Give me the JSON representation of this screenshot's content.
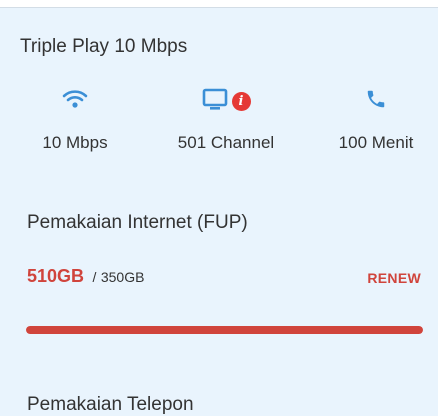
{
  "plan": {
    "title": "Triple Play 10 Mbps",
    "features": [
      {
        "icon": "wifi-icon",
        "label": "10 Mbps"
      },
      {
        "icon": "tv-icon",
        "label": "501 Channel",
        "badge": "i"
      },
      {
        "icon": "phone-icon",
        "label": "100 Menit"
      }
    ]
  },
  "usage": {
    "title": "Pemakaian Internet (FUP)",
    "used": "510GB",
    "separator": "/",
    "quota": "350GB",
    "renew_label": "RENEW",
    "progress_fraction": 1.0
  },
  "next_section": {
    "title": "Pemakaian Telepon"
  },
  "colors": {
    "background": "#e9f4fd",
    "accent_blue": "#3b8fd6",
    "alert_red": "#d0443c",
    "text": "#333333"
  }
}
